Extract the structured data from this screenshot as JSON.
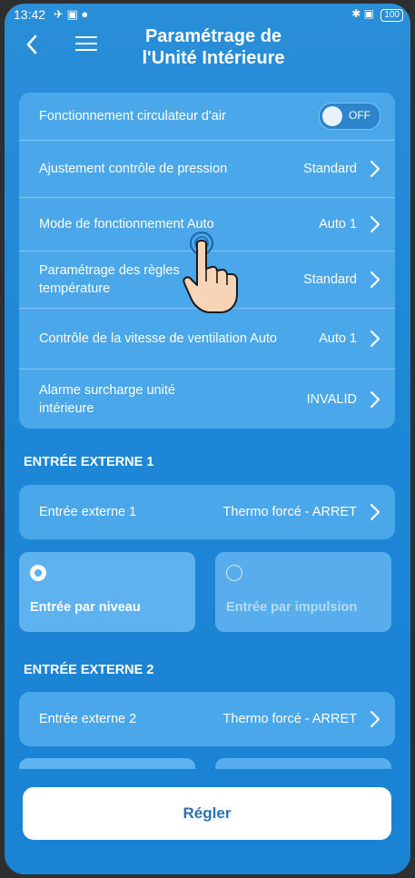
{
  "status": {
    "time": "13:42",
    "battery": "100"
  },
  "header": {
    "title_line1": "Paramétrage de",
    "title_line2": "l'Unité Intérieure"
  },
  "settings": {
    "fan_circulator": {
      "label": "Fonctionnement circulateur d'air",
      "toggle_label": "OFF"
    },
    "pressure_control": {
      "label": "Ajustement contrôle de pression",
      "value": "Standard"
    },
    "auto_mode": {
      "label": "Mode de fonctionnement Auto",
      "value": "Auto 1"
    },
    "temp_rules": {
      "label": "Paramétrage des règles température",
      "value": "Standard"
    },
    "vent_speed": {
      "label": "Contrôle de la vitesse de ventilation Auto",
      "value": "Auto 1"
    },
    "overload_alarm": {
      "label": "Alarme surcharge unité intérieure",
      "value": "INVALID"
    }
  },
  "external1": {
    "section_title": "ENTRÉE EXTERNE 1",
    "row_label": "Entrée externe 1",
    "row_value": "Thermo forcé - ARRET",
    "choice_level": "Entrée par niveau",
    "choice_pulse": "Entrée par impulsion"
  },
  "external2": {
    "section_title": "ENTRÉE EXTERNE 2",
    "row_label": "Entrée externe 2",
    "row_value": "Thermo forcé - ARRET"
  },
  "actions": {
    "apply_label": "Régler"
  }
}
